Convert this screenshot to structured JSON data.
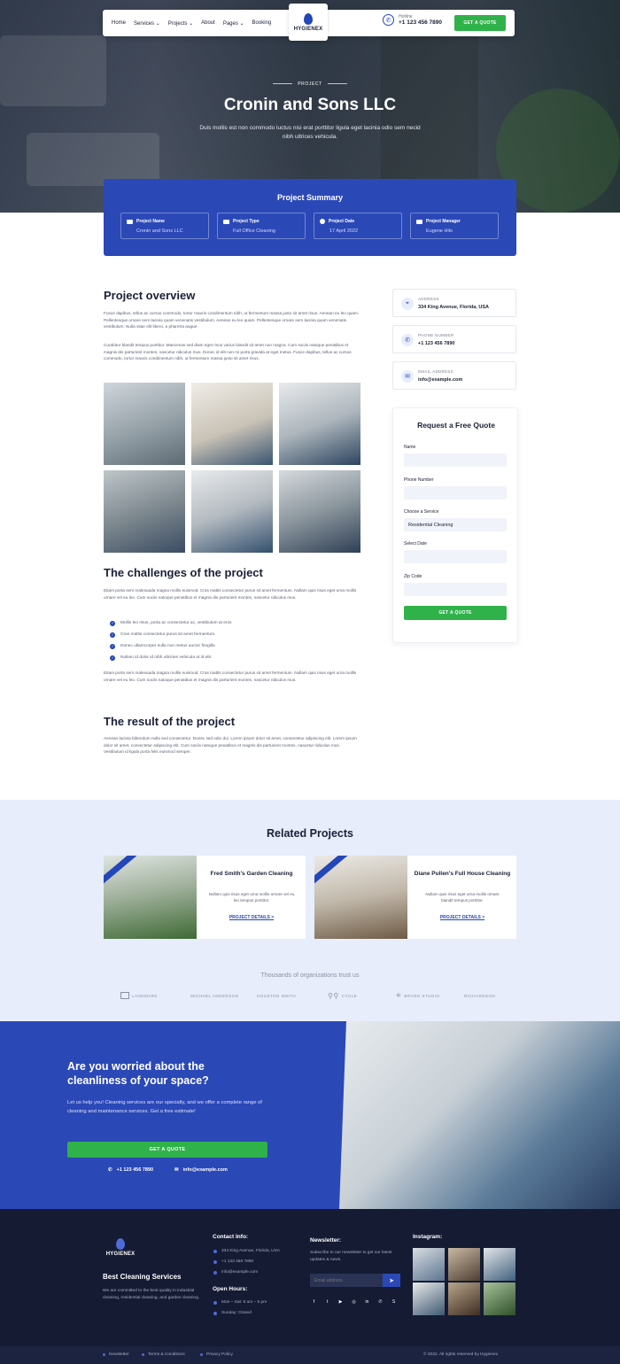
{
  "nav": {
    "items": [
      "Home",
      "Services",
      "Projects",
      "About",
      "Pages",
      "Booking"
    ],
    "logo": "HYGIENEX",
    "hotline_label": "Hotline",
    "hotline_number": "+1 123 456 7890",
    "cta": "GET A QUOTE"
  },
  "hero": {
    "eyebrow": "PROJECT",
    "title": "Cronin and Sons LLC",
    "subtitle": "Duis mollis est non commodo luctus nisi erat porttitor ligula eget lacinia odio sem necid nibh ultrices vehicula."
  },
  "summary": {
    "title": "Project Summary",
    "cards": [
      {
        "label": "Project Name",
        "value": "Cronin and Sons LLC"
      },
      {
        "label": "Project Type",
        "value": "Full Office Cleaning"
      },
      {
        "label": "Project Date",
        "value": "17 April 2022"
      },
      {
        "label": "Project Manager",
        "value": "Eugene Hilo"
      }
    ]
  },
  "overview": {
    "heading": "Project overview",
    "p1": "Fusce dapibus, tellus ac cursus commodo, tortor mauris condimentum nibh, ut fermentum massa justo sit amet risus. Aenean eu leo quam. Pellentesque ornare sem lacinia quam venenatis vestibulum. Aenean eu leo quam. Pellentesque ornare sem lacinia quam venenatis vestibulum. Nulla vitae elit libero, a pharetra augue.",
    "p2": "Curabitur blandit tempus porttitor. Maecenas sed diam eget risus varius blandit sit amet non magna. Cum sociis natoque penatibus et magnis dis parturient montes, nascetur ridiculus mus. Donec id elit non mi porta gravida at eget metus. Fusce dapibus, tellus ac cursus commodo, tortor mauris condimentum nibh, ut fermentum massa justo sit amet risus."
  },
  "challenges": {
    "heading": "The challenges of the project",
    "p1": "Etiam porta sem malesuada magna mollis euismod. Cras mattis consectetur purus sit amet fermentum. Nullam quis risus eget urna mollis ornare vel eu leo. Cum sociis natoque penatibus et magnis dis parturient montes, nascetur ridiculus mus.",
    "list": [
      "Mollis leo risus, porta ac consectetur ac, vestibulum at eros",
      "Cras mattis consectetur purus sit amet fermentum.",
      "Donec ullamcorper nulla non metus auctor fringilla",
      "Nullam id dolor id nibh ultricies vehicula ut id elit."
    ],
    "p2": "Etiam porta sem malesuada magna mollis euismod. Cras mattis consectetur purus sit amet fermentum. Nullam quis risus eget urna mollis ornare vel eu leo. Cum sociis natoque penatibus et magnis dis parturient montes, nascetur ridiculus mus."
  },
  "result": {
    "heading": "The result of the project",
    "p": "Aenean lacinia bibendum nulla sed consectetur. Donec sed odio dui. Lorem ipsum dolor sit amet, consectetur adipiscing elit. Lorem ipsum dolor sit amet, consectetur adipiscing elit. Cum sociis natoque penatibus et magnis dis parturient montes, nascetur ridiculus mus. Vestibulum id ligula porta felis euismod semper."
  },
  "contact": [
    {
      "label": "ADDRESS",
      "value": "334 King Avenue, Florida, USA",
      "icon": "location-icon"
    },
    {
      "label": "PHONE NUMBER",
      "value": "+1 123 456 7890",
      "icon": "phone-icon"
    },
    {
      "label": "EMAIL ADDRESS",
      "value": "info@example.com",
      "icon": "mail-icon"
    }
  ],
  "quote": {
    "title": "Request a Free Quote",
    "fields": [
      {
        "label": "Name",
        "value": ""
      },
      {
        "label": "Phone Number",
        "value": ""
      },
      {
        "label": "Choose a Service",
        "value": "Residential Cleaning"
      },
      {
        "label": "Select Date",
        "value": ""
      },
      {
        "label": "Zip Code",
        "value": ""
      }
    ],
    "button": "GET A QUOTE"
  },
  "related": {
    "heading": "Related Projects",
    "items": [
      {
        "title": "Fred Smith's Garden Cleaning",
        "desc": "Nullam quis risus eget urna mollis ornare vel eu leo tempus porttitor.",
        "link": "PROJECT DETAILS >"
      },
      {
        "title": "Diane Pullen's Full House Cleaning",
        "desc": "Nullam quis risus eget urna mollis ornare blandit tempus porttitor.",
        "link": "PROJECT DETAILS >"
      }
    ]
  },
  "trust": {
    "heading": "Thousands of organizations trust us",
    "logos": [
      "LANDMARK",
      "MICHAEL ANDERSON",
      "HOUSTON SMITH",
      "CYCLE",
      "BRAND STUDIO",
      "RICHARDSON"
    ]
  },
  "cta": {
    "title": "Are you worried about the cleanliness of your space?",
    "text": "Let us help you! Cleaning services are our specialty, and we offer a complete range of cleaning and maintenance services. Get a free estimate!",
    "button": "GET A QUOTE",
    "phone": "+1 123 456 7890",
    "email": "info@example.com"
  },
  "footer": {
    "logo": "HYGIENEX",
    "tagline": "Best Cleaning Services",
    "about": "We are committed to the best quality in industrial cleaning, residential cleaning, and garden cleaning.",
    "contact_heading": "Contact Info:",
    "contact": [
      "334 King Avenue, Florida, USA",
      "+1 123 456 7890",
      "info@example.com"
    ],
    "hours_heading": "Open Hours:",
    "hours": [
      "Mon – Sat: 8 am – 5 pm",
      "Sunday: Closed"
    ],
    "newsletter_heading": "Newsletter:",
    "newsletter_text": "Subscribe to our newsletter to get our latest updates & news.",
    "newsletter_placeholder": "Email address",
    "instagram_heading": "Instagram:",
    "bottom_links": [
      "Newsletter",
      "Terms & Conditions",
      "Privacy Policy"
    ],
    "copyright": "© 2022. All rights reserved by Hygienex."
  },
  "colors": {
    "primary": "#2b48b7",
    "accent": "#2fb24a",
    "dark": "#141b33"
  }
}
